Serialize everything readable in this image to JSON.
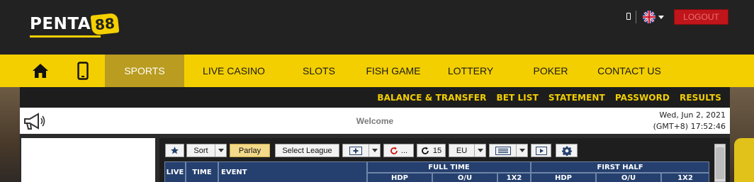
{
  "header": {
    "logo": {
      "text": "PENTA",
      "badge": "88"
    },
    "logout_label": "LOGOUT",
    "language_icon": "uk-flag-icon"
  },
  "mainnav": {
    "items": [
      {
        "label": "SPORTS",
        "active": true
      },
      {
        "label": "LIVE CASINO"
      },
      {
        "label": "SLOTS"
      },
      {
        "label": "FISH GAME"
      },
      {
        "label": "LOTTERY"
      },
      {
        "label": "POKER"
      },
      {
        "label": "CONTACT US"
      }
    ]
  },
  "subnav": {
    "links": [
      "BALANCE & TRANSFER",
      "BET LIST",
      "STATEMENT",
      "PASSWORD",
      "RESULTS"
    ]
  },
  "welcome": {
    "text": "Welcome",
    "date": "Wed, Jun 2, 2021",
    "time": "(GMT+8) 17:52:46"
  },
  "toolbar": {
    "sort_label": "Sort",
    "parlay_label": "Parlay",
    "select_league_label": "Select League",
    "refresh_more": "...",
    "refresh_seconds": "15",
    "odds_type": "EU"
  },
  "table": {
    "cols": {
      "live": "LIVE",
      "time": "TIME",
      "event": "EVENT"
    },
    "full_time": "FULL TIME",
    "first_half": "FIRST HALF",
    "sub": {
      "hdp": "HDP",
      "ou": "O/U",
      "x12": "1X2"
    }
  },
  "colors": {
    "brand_yellow": "#f3cf00",
    "nav_active": "#b99c20",
    "header_dark": "#222222",
    "logout_red": "#c0151b",
    "table_header": "#25406e"
  }
}
